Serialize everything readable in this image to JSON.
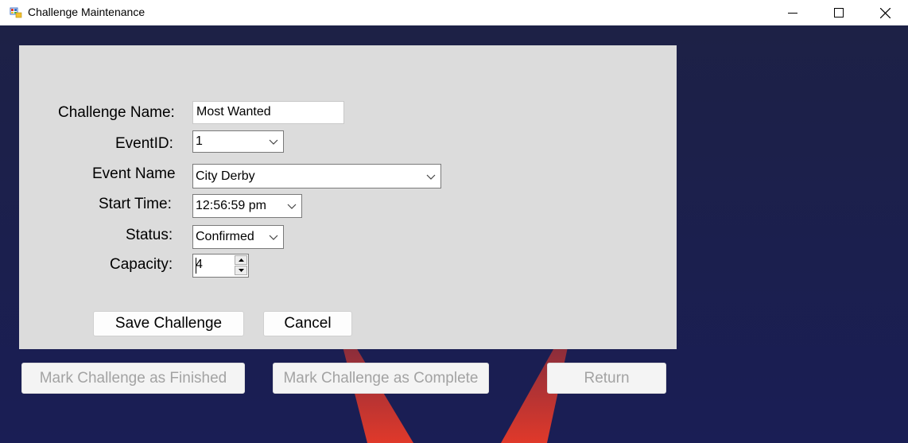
{
  "window": {
    "title": "Challenge Maintenance"
  },
  "form": {
    "challenge_name": {
      "label": "Challenge Name:",
      "value": "Most Wanted"
    },
    "event_id": {
      "label": "EventID:",
      "value": "1"
    },
    "event_name": {
      "label": "Event Name",
      "value": "City Derby"
    },
    "start_time": {
      "label": "Start Time:",
      "value": "12:56:59 pm"
    },
    "status": {
      "label": "Status:",
      "value": "Confirmed"
    },
    "capacity": {
      "label": "Capacity:",
      "value": "4"
    }
  },
  "actions": {
    "save_label": "Save Challenge",
    "cancel_label": "Cancel"
  },
  "bottom_actions": {
    "mark_finished_label": "Mark Challenge as Finished",
    "mark_complete_label": "Mark Challenge as Complete",
    "return_label": "Return"
  },
  "colors": {
    "panel": "#dcdcdc",
    "background": "#1d2146",
    "beam": "#e0392a"
  }
}
